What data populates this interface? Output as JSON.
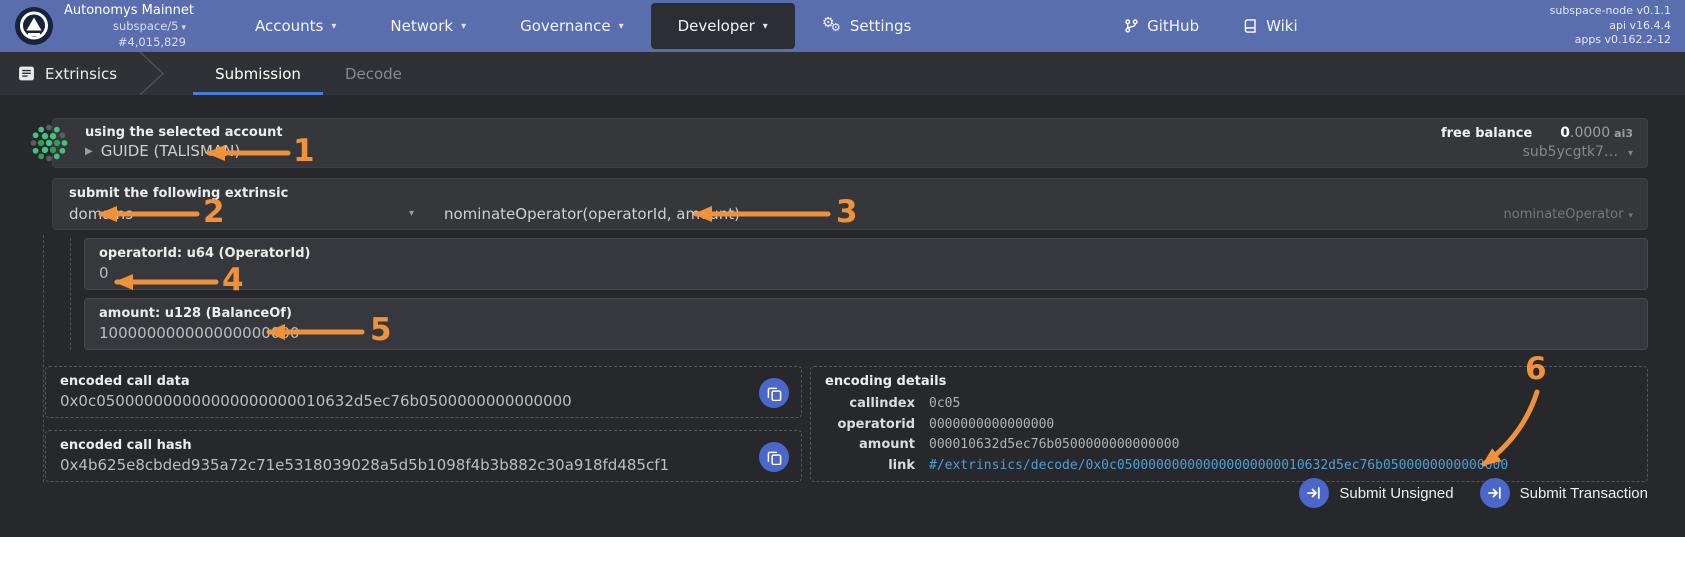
{
  "colors": {
    "header_blue": "#5a6eae",
    "accent_blue": "#4a67c9",
    "tab_underline": "#4a79e0",
    "link_blue": "#4e9ed4",
    "annotation_orange": "#f0923c",
    "content_bg": "#26282c"
  },
  "header": {
    "network": "Autonomys Mainnet",
    "runtime": "subspace/5",
    "best_block": "#4,015,829",
    "nav": [
      {
        "label": "Accounts"
      },
      {
        "label": "Network"
      },
      {
        "label": "Governance"
      },
      {
        "label": "Developer"
      },
      {
        "label": "Settings"
      }
    ],
    "external": [
      {
        "label": "GitHub"
      },
      {
        "label": "Wiki"
      }
    ],
    "versions": [
      "subspace-node v0.1.1",
      "api v16.4.4",
      "apps v0.162.2-12"
    ]
  },
  "tabbar": {
    "section": "Extrinsics",
    "tabs": [
      {
        "label": "Submission"
      },
      {
        "label": "Decode"
      }
    ]
  },
  "account": {
    "label": "using the selected account",
    "name": "GUIDE (TALISMAN)",
    "free_balance_label": "free balance",
    "balance_int": "0",
    "balance_frac": ".0000",
    "balance_unit": "ai3",
    "address_short": "sub5ycgtk7…"
  },
  "extrinsic": {
    "label": "submit the following extrinsic",
    "pallet": "domains",
    "method_signature": "nominateOperator(operatorId, amount)",
    "method_name": "nominateOperator",
    "params": [
      {
        "label": "operatorId: u64 (OperatorId)",
        "value": "0"
      },
      {
        "label": "amount: u128 (BalanceOf)",
        "value": "100000000000000000000"
      }
    ]
  },
  "outputs": {
    "call_data_label": "encoded call data",
    "call_data": "0x0c050000000000000000000010632d5ec76b0500000000000000",
    "call_hash_label": "encoded call hash",
    "call_hash": "0x4b625e8cbded935a72c71e5318039028a5d5b1098f4b3b882c30a918fd485cf1"
  },
  "encoding_details": {
    "title": "encoding details",
    "rows": [
      {
        "label": "callindex",
        "value": "0c05"
      },
      {
        "label": "operatorid",
        "value": "0000000000000000"
      },
      {
        "label": "amount",
        "value": "000010632d5ec76b0500000000000000"
      },
      {
        "label": "link",
        "value": "#/extrinsics/decode/0x0c050000000000000000000010632d5ec76b0500000000000000"
      }
    ]
  },
  "actions": {
    "submit_unsigned": "Submit Unsigned",
    "submit_transaction": "Submit Transaction"
  },
  "annotations": {
    "a1": "1",
    "a2": "2",
    "a3": "3",
    "a4": "4",
    "a5": "5",
    "a6": "6"
  }
}
